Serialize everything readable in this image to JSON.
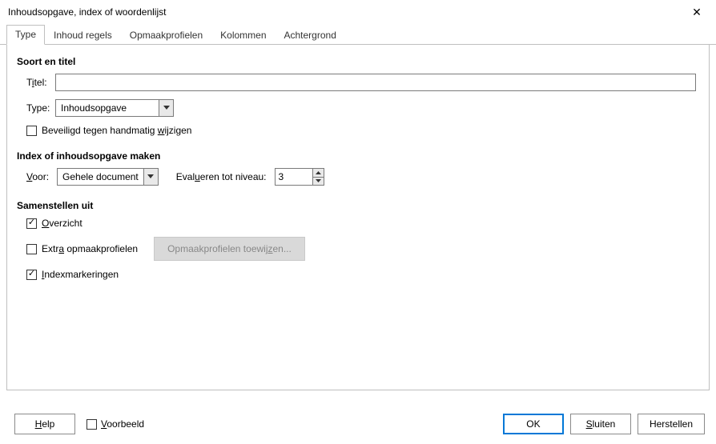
{
  "window": {
    "title": "Inhoudsopgave, index of woordenlijst"
  },
  "tabs": {
    "type": "Type",
    "inhoud_regels": "Inhoud regels",
    "opmaakprofielen": "Opmaakprofielen",
    "kolommen": "Kolommen",
    "achtergrond": "Achtergrond"
  },
  "section_soort": {
    "heading": "Soort en titel",
    "titel_label_pre": "T",
    "titel_label_u": "i",
    "titel_label_post": "tel:",
    "titel_value": "",
    "type_label": "Type:",
    "type_value": "Inhoudsopgave",
    "protect_pre": "Beveiligd tegen handmatig ",
    "protect_u": "w",
    "protect_post": "ijzigen"
  },
  "section_index": {
    "heading": "Index of inhoudsopgave maken",
    "voor_u": "V",
    "voor_post": "oor:",
    "voor_value": "Gehele document",
    "eval_pre": "Eval",
    "eval_u": "u",
    "eval_post": "eren tot niveau:",
    "eval_value": "3"
  },
  "section_samen": {
    "heading": "Samenstellen uit",
    "overzicht_u": "O",
    "overzicht_post": "verzicht",
    "extra_pre": "Extr",
    "extra_u": "a",
    "extra_post": " opmaakprofielen",
    "assign_pre": "Opmaakprofielen toewij",
    "assign_u": "z",
    "assign_post": "en...",
    "idx_u": "I",
    "idx_post": "ndexmarkeringen"
  },
  "buttons": {
    "help_u": "H",
    "help_post": "elp",
    "voorbeeld_u": "V",
    "voorbeeld_post": "oorbeeld",
    "ok": "OK",
    "sluiten_u": "S",
    "sluiten_post": "luiten",
    "herstellen_u": "",
    "herstellen": "Herstellen"
  }
}
